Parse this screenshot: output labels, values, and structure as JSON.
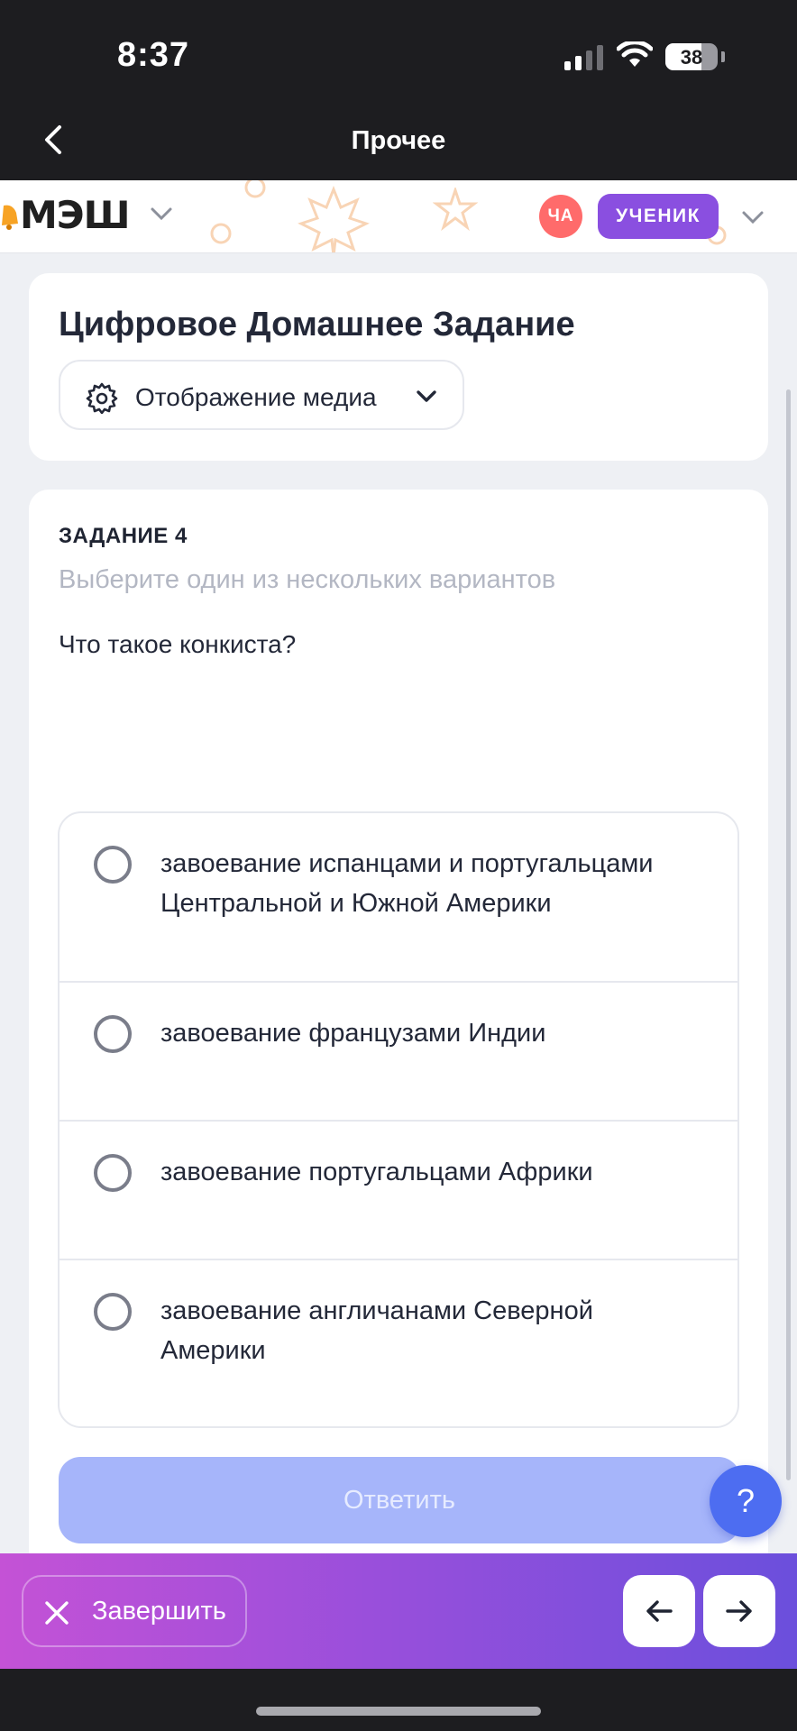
{
  "status_bar": {
    "time": "8:37",
    "battery": "38"
  },
  "nav": {
    "title": "Прочее"
  },
  "header": {
    "logo": "МЭШ",
    "user_initials": "ЧА",
    "role": "УЧЕНИК"
  },
  "homework": {
    "title": "Цифровое Домашнее Задание",
    "media_button": "Отображение медиа"
  },
  "task": {
    "number": "ЗАДАНИЕ 4",
    "hint": "Выберите один из нескольких вариантов",
    "question": "Что такое конкиста?",
    "options": [
      {
        "text": "завоевание испанцами и португальцами Центральной и Южной Америки",
        "selected": false
      },
      {
        "text": "завоевание французами Индии",
        "selected": false
      },
      {
        "text": "завоевание португальцами Африки",
        "selected": false
      },
      {
        "text": "завоевание англичанами Северной Америки",
        "selected": false
      }
    ],
    "submit_label": "Ответить"
  },
  "help": {
    "label": "?"
  },
  "bottom_bar": {
    "finish_label": "Завершить",
    "prev_icon": "arrow-left-icon",
    "next_icon": "arrow-right-icon"
  },
  "colors": {
    "accent": "#4d6df1",
    "role_badge": "#8a4fe0",
    "avatar": "#ff6b6b",
    "submit_disabled": "#a6b5fa",
    "gradient_start": "#c452d6",
    "gradient_end": "#6b4fdc"
  }
}
